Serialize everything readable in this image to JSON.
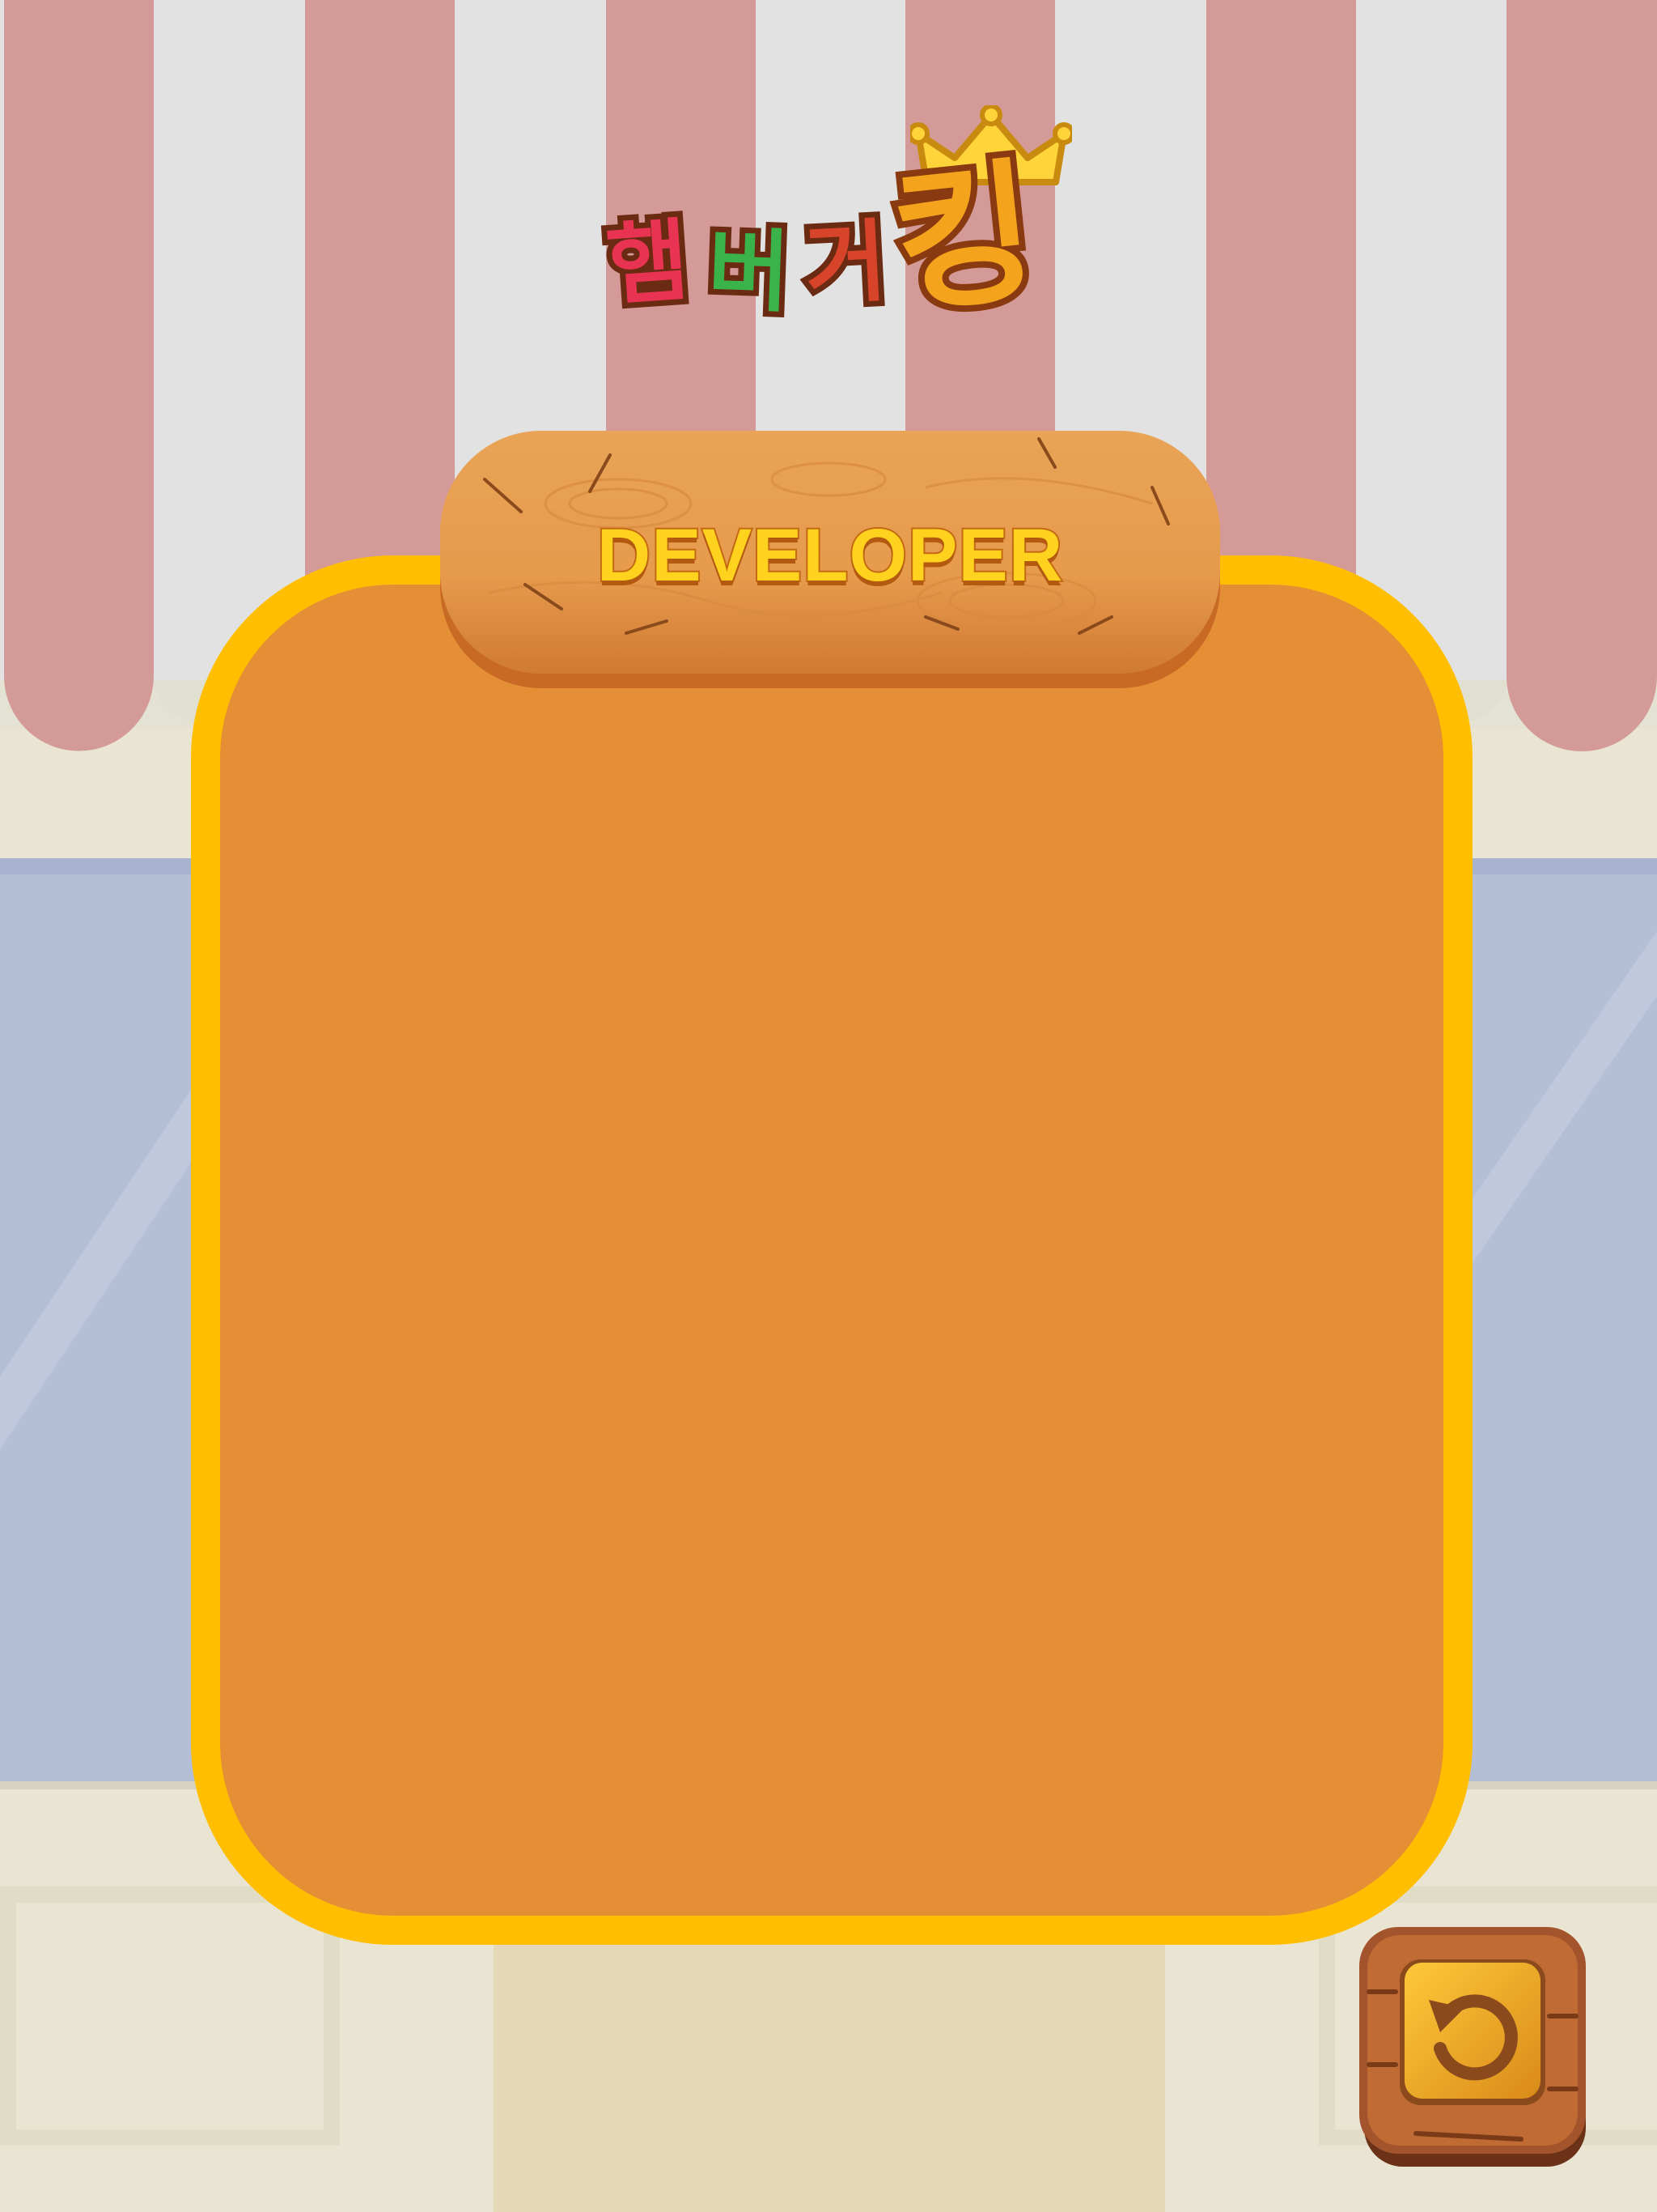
{
  "logo": {
    "syllables": [
      "햄",
      "버",
      "거",
      "킹"
    ]
  },
  "sign": {
    "title": "DEVELOPER"
  },
  "back_button": {
    "icon": "undo-arrow-icon"
  },
  "colors": {
    "stripe_red": "#d49a97",
    "stripe_white": "#e2e2e2",
    "window_blue": "#b4bfd6",
    "panel_fill": "#e48e36",
    "panel_border": "#ffbf00",
    "wood": "#e79a4c",
    "title_text": "#ffd21e"
  }
}
